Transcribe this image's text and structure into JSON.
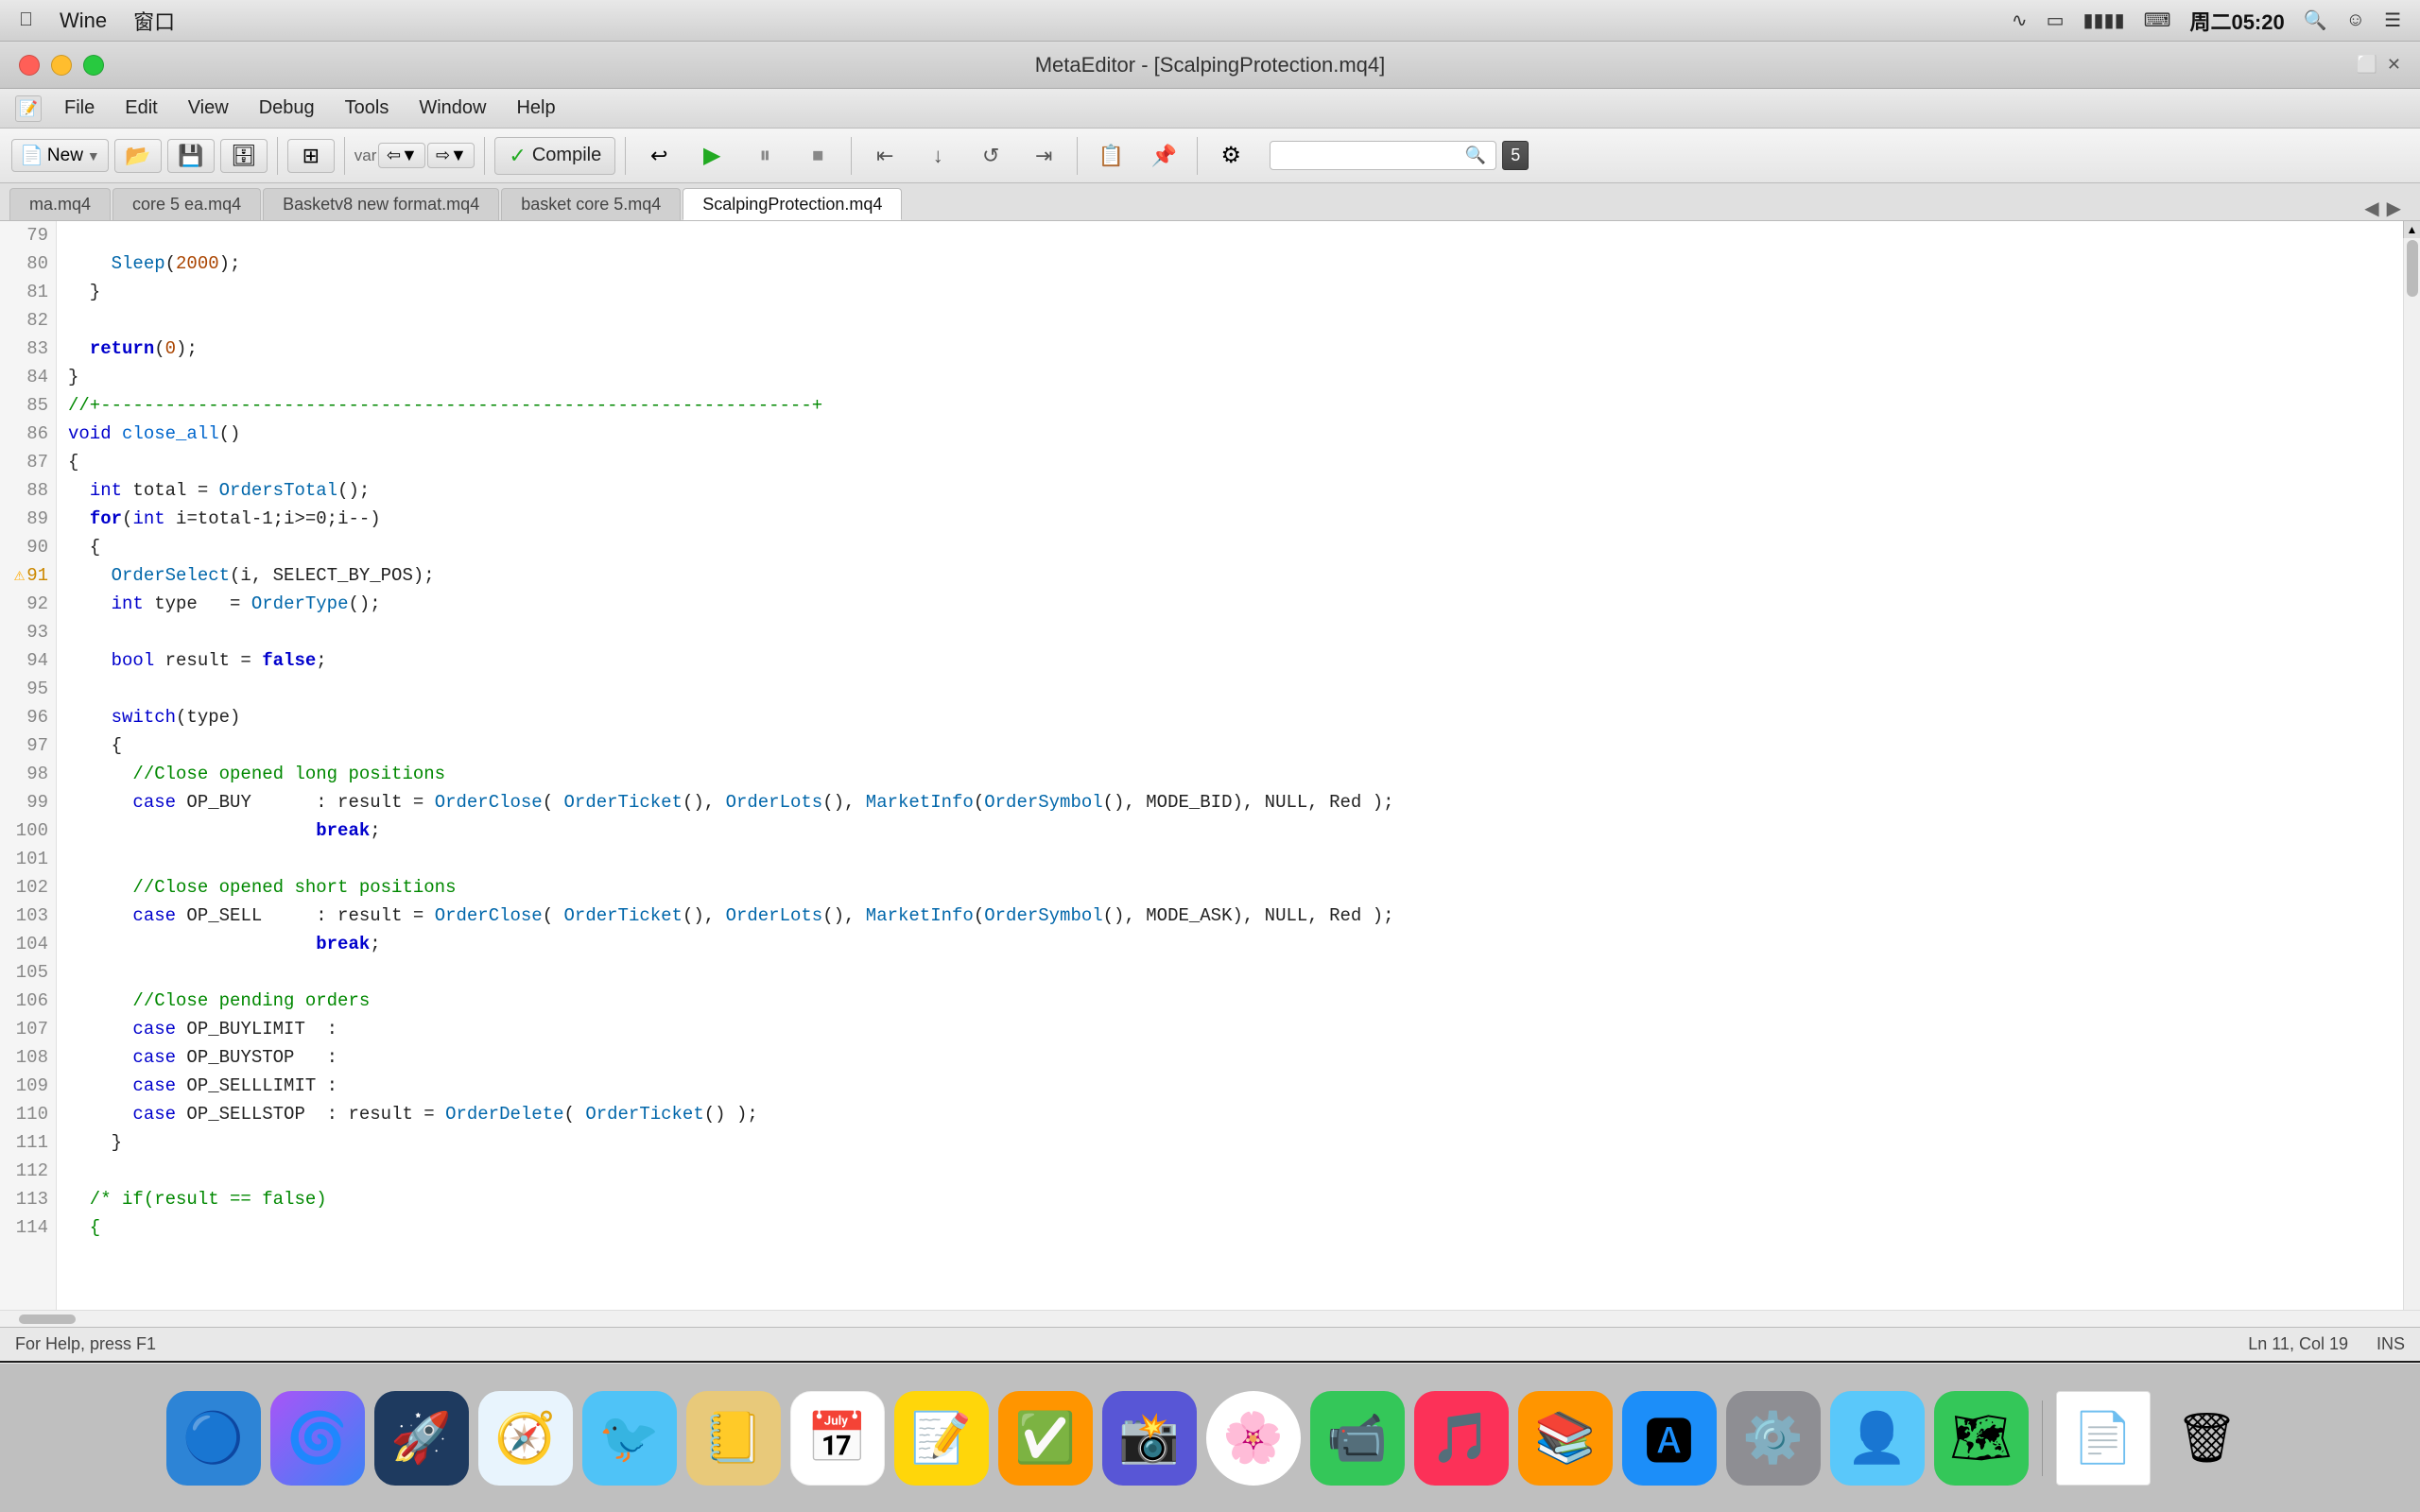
{
  "menubar": {
    "apple": "🍎",
    "items": [
      "Wine",
      "窗口"
    ],
    "right_icons": [
      "wifi",
      "cast",
      "battery",
      "grid",
      "time",
      "search",
      "user",
      "menu"
    ],
    "time": "周二05:20"
  },
  "titlebar": {
    "title": "MetaEditor - [ScalpingProtection.mq4]",
    "window_controls": {
      "close": "close",
      "minimize": "minimize",
      "maximize": "maximize"
    }
  },
  "menu": {
    "items": [
      "File",
      "Edit",
      "View",
      "Debug",
      "Tools",
      "Window",
      "Help"
    ]
  },
  "toolbar": {
    "new_label": "New",
    "compile_label": "Compile",
    "search_placeholder": ""
  },
  "tabs": {
    "items": [
      {
        "label": "ma.mq4",
        "active": false
      },
      {
        "label": "core 5 ea.mq4",
        "active": false
      },
      {
        "label": "Basketv8 new format.mq4",
        "active": false
      },
      {
        "label": "basket core 5.mq4",
        "active": false
      },
      {
        "label": "ScalpingProtection.mq4",
        "active": true
      }
    ]
  },
  "code": {
    "lines": [
      {
        "num": "79",
        "content": ""
      },
      {
        "num": "80",
        "content": "    Sleep(2000);"
      },
      {
        "num": "81",
        "content": "  }"
      },
      {
        "num": "82",
        "content": ""
      },
      {
        "num": "83",
        "content": "  return(0);"
      },
      {
        "num": "84",
        "content": "}"
      },
      {
        "num": "85",
        "content": "//+------------------------------------------------------------------+"
      },
      {
        "num": "86",
        "content": "void close_all()"
      },
      {
        "num": "87",
        "content": "{"
      },
      {
        "num": "88",
        "content": "  int total = OrdersTotal();"
      },
      {
        "num": "89",
        "content": "  for(int i=total-1;i>=0;i--)"
      },
      {
        "num": "90",
        "content": "  {"
      },
      {
        "num": "91",
        "content": "    OrderSelect(i, SELECT_BY_POS);",
        "warn": true
      },
      {
        "num": "92",
        "content": "    int type   = OrderType();"
      },
      {
        "num": "93",
        "content": ""
      },
      {
        "num": "94",
        "content": "    bool result = false;"
      },
      {
        "num": "95",
        "content": ""
      },
      {
        "num": "96",
        "content": "    switch(type)"
      },
      {
        "num": "97",
        "content": "    {"
      },
      {
        "num": "98",
        "content": "      //Close opened long positions"
      },
      {
        "num": "99",
        "content": "      case OP_BUY      : result = OrderClose( OrderTicket(), OrderLots(), MarketInfo(OrderSymbol(), MODE_BID), NULL, Red );"
      },
      {
        "num": "100",
        "content": "                         break;"
      },
      {
        "num": "101",
        "content": ""
      },
      {
        "num": "102",
        "content": "      //Close opened short positions"
      },
      {
        "num": "103",
        "content": "      case OP_SELL     : result = OrderClose( OrderTicket(), OrderLots(), MarketInfo(OrderSymbol(), MODE_ASK), NULL, Red );"
      },
      {
        "num": "104",
        "content": "                         break;"
      },
      {
        "num": "105",
        "content": ""
      },
      {
        "num": "106",
        "content": "      //Close pending orders"
      },
      {
        "num": "107",
        "content": "      case OP_BUYLIMIT  :"
      },
      {
        "num": "108",
        "content": "      case OP_BUYSTOP   :"
      },
      {
        "num": "109",
        "content": "      case OP_SELLLIMIT :"
      },
      {
        "num": "110",
        "content": "      case OP_SELLSTOP  : result = OrderDelete( OrderTicket() );"
      },
      {
        "num": "111",
        "content": "    }"
      },
      {
        "num": "112",
        "content": ""
      },
      {
        "num": "113",
        "content": "  /* if(result == false)"
      },
      {
        "num": "114",
        "content": "  {"
      }
    ]
  },
  "statusbar": {
    "help_text": "For Help, press F1",
    "ln_col": "Ln 11, Col 19",
    "mode": "INS"
  },
  "dock": {
    "icons": [
      {
        "name": "finder",
        "emoji": "🔵",
        "bg": "#2d84d6",
        "label": "Finder"
      },
      {
        "name": "siri",
        "emoji": "🌀",
        "bg": "linear-gradient(135deg,#a855f7,#3b82f6)",
        "label": "Siri"
      },
      {
        "name": "launchpad",
        "emoji": "🚀",
        "bg": "#1e3a5f",
        "label": "Launchpad"
      },
      {
        "name": "safari",
        "emoji": "🧭",
        "bg": "#1a73e8",
        "label": "Safari"
      },
      {
        "name": "mail-bird",
        "emoji": "🐦",
        "bg": "#4fc3f7",
        "label": "Thunderbird"
      },
      {
        "name": "contacts",
        "emoji": "📒",
        "bg": "#e8c97a",
        "label": "Contacts"
      },
      {
        "name": "calendar",
        "emoji": "📅",
        "bg": "#ff3b30",
        "label": "Calendar"
      },
      {
        "name": "notes",
        "emoji": "📝",
        "bg": "#ffd60a",
        "label": "Notes"
      },
      {
        "name": "reminders",
        "emoji": "✅",
        "bg": "#ff9500",
        "label": "Reminders"
      },
      {
        "name": "photos-capture",
        "emoji": "📸",
        "bg": "#5856d6",
        "label": "Photos Capture"
      },
      {
        "name": "photos",
        "emoji": "🌸",
        "bg": "linear-gradient(135deg,#f7797d,#fbd786,#c6ffdd)",
        "label": "Photos"
      },
      {
        "name": "facetime",
        "emoji": "📹",
        "bg": "#34c759",
        "label": "FaceTime"
      },
      {
        "name": "music",
        "emoji": "🎵",
        "bg": "#fc3158",
        "label": "Music"
      },
      {
        "name": "books",
        "emoji": "📚",
        "bg": "#ff9500",
        "label": "Books"
      },
      {
        "name": "appstore",
        "emoji": "🅰",
        "bg": "#1c8ef9",
        "label": "App Store"
      },
      {
        "name": "settings",
        "emoji": "⚙️",
        "bg": "#8e8e93",
        "label": "System Preferences"
      },
      {
        "name": "contacts2",
        "emoji": "👤",
        "bg": "#5ac8fa",
        "label": "Contacts"
      },
      {
        "name": "maps",
        "emoji": "🗺",
        "bg": "#34c759",
        "label": "Maps"
      },
      {
        "name": "sep1",
        "type": "sep"
      },
      {
        "name": "doc",
        "emoji": "📄",
        "bg": "#ffffff",
        "label": "Document"
      },
      {
        "name": "trash",
        "emoji": "🗑",
        "bg": "#8e8e93",
        "label": "Trash"
      }
    ]
  }
}
